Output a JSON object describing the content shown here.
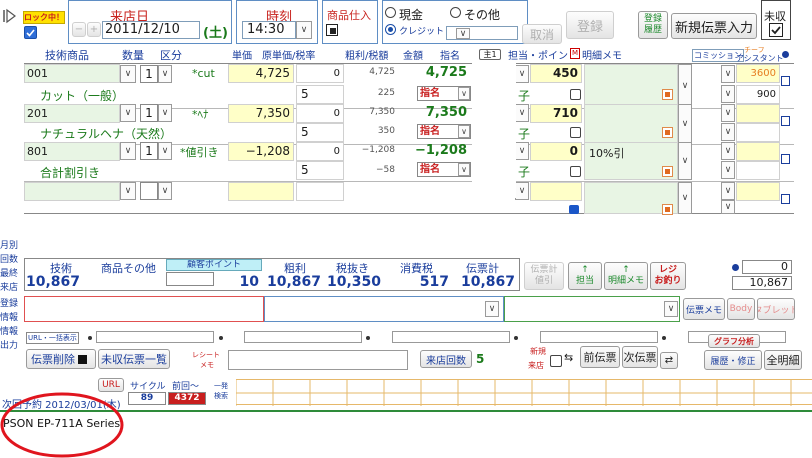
{
  "header": {
    "lock_badge": "ロック中！",
    "visit_date_label": "来店日",
    "visit_date": "2011/12/10",
    "weekday": "(土)",
    "time_label": "時刻",
    "time_value": "14:30",
    "purchase_label": "商品仕入",
    "cash_label": "現金",
    "other_label": "その他",
    "credit_label": "クレジット",
    "cancel_label": "取消",
    "register_label": "登録",
    "history_label_1": "登録",
    "history_label_2": "履歴",
    "new_slip_label": "新規伝票入力",
    "unreceived_label": "未収"
  },
  "columns": {
    "technique": "技術商品",
    "qty": "数量",
    "category": "区分",
    "unit_price": "単価",
    "cost_tax": "原単価/税率",
    "profit_tax": "粗利/税額",
    "amount": "金額",
    "designation": "指名",
    "staff_points": "担当・ポイント",
    "memo": "明細メモ",
    "commission": "コミッション",
    "chief_1": "チーフ",
    "chief_2": "アシスタント",
    "staff_badge": "主1"
  },
  "rows": [
    {
      "code": "001",
      "qty": "1",
      "category": "*cut",
      "unit_price": "4,725",
      "cost": "0",
      "profit": "4,725",
      "amount": "4,725",
      "points": "450",
      "name": "カット（一般）",
      "tax_rate": "5",
      "tax": "225",
      "designate": "指名",
      "staff_suffix": "子",
      "memo": "",
      "comm_1": "3600",
      "comm_2": "900"
    },
    {
      "code": "201",
      "qty": "1",
      "category": "*ﾍﾅ",
      "unit_price": "7,350",
      "cost": "0",
      "profit": "7,350",
      "amount": "7,350",
      "points": "710",
      "name": "ナチュラルヘナ（天然）",
      "tax_rate": "5",
      "tax": "350",
      "designate": "指名",
      "staff_suffix": "子",
      "memo": "",
      "comm_1": "",
      "comm_2": ""
    },
    {
      "code": "801",
      "qty": "1",
      "category": "*値引き",
      "unit_price": "−1,208",
      "cost": "0",
      "profit": "−1,208",
      "amount": "−1,208",
      "points": "0",
      "name": "合計割引き",
      "tax_rate": "5",
      "tax": "−58",
      "designate": "指名",
      "staff_suffix": "子",
      "memo": "10%引",
      "comm_1": "",
      "comm_2": ""
    }
  ],
  "totals": {
    "technique_label": "技術",
    "technique_value": "10,867",
    "other_label": "商品その他",
    "other_value": "",
    "points_label": "顧客ポイント",
    "points_value": "10",
    "profit_label": "粗利",
    "profit_value": "10,867",
    "pretax_label": "税抜き",
    "pretax_value": "10,350",
    "tax_label": "消費税",
    "tax_value": "517",
    "total_label": "伝票計",
    "total_value": "10,867",
    "slip_calc_1": "伝票計",
    "slip_calc_2": "値引",
    "staff_btn": "担当",
    "memo_btn": "明細メモ",
    "register_1": "レジ",
    "register_2": "お釣り",
    "right_top": "0",
    "right_bottom": "10,867"
  },
  "sidebar": [
    "月別",
    "回数",
    "最終",
    "来店",
    "登録",
    "情報",
    "情報",
    "出力"
  ],
  "toolbar": {
    "slip_memo": "伝票メモ",
    "body": "Body",
    "tablet": "タブレット",
    "url_bulk": "URL・一括表示",
    "delete_slip": "伝票削除",
    "unreceived_list": "未収伝票一覧",
    "receipt_1": "レシート",
    "receipt_2": "メモ",
    "visit_count_label": "来店回数",
    "visit_count": "5",
    "new_visit_1": "新規",
    "new_visit_2": "来店",
    "prev_slip": "前伝票",
    "next_slip": "次伝票",
    "graph": "グラフ分析",
    "history_edit": "履歴・修正",
    "all_details": "全明細"
  },
  "cycle": {
    "url": "URL",
    "cycle": "サイクル",
    "before": "前回〜",
    "cycle_value": "89",
    "before_value": "4372",
    "oneshot_1": "一発",
    "oneshot_2": "検索",
    "next_visit": "次回予約 2012/03/01(木)"
  },
  "status": {
    "printer": "PSON EP-711A Series"
  },
  "colors": {
    "accent_red": "#c8231e",
    "accent_green": "#1b7a1b",
    "annotation_red": "#e0151e"
  }
}
